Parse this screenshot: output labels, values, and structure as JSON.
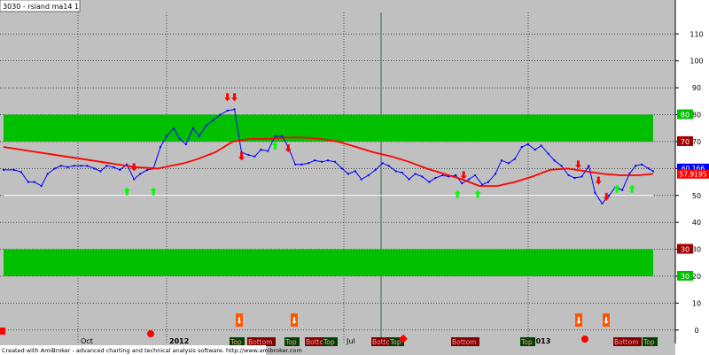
{
  "title": "3030 - rsiand ma14 1",
  "footer": "Created with AmiBroker - advanced charting and technical analysis software. http://www.amibroker.com",
  "colors": {
    "background": "#c0c0c0",
    "band": "#00c000",
    "rsi_line": "#0000ff",
    "ma_line": "#ff0000",
    "up_arrow": "#00ff00",
    "down_arrow": "#ff0000",
    "marker": "#ff0000"
  },
  "chart_data": {
    "type": "line",
    "ylim": [
      -5,
      118
    ],
    "yticks": [
      0,
      10,
      20,
      30,
      40,
      50,
      60,
      70,
      80,
      90,
      100,
      110
    ],
    "xticks": [
      {
        "label": "Oct",
        "x": 88
      },
      {
        "label": "2012",
        "x": 188
      },
      {
        "label": "Jul",
        "x": 388
      },
      {
        "label": "2013",
        "x": 596
      }
    ],
    "series": [
      {
        "id": "rsi",
        "points": [
          [
            0,
            59.5
          ],
          [
            12,
            59.5
          ],
          [
            20,
            58.7
          ],
          [
            28,
            55
          ],
          [
            35,
            55
          ],
          [
            43,
            53.5
          ],
          [
            50,
            58
          ],
          [
            58,
            60
          ],
          [
            65,
            61
          ],
          [
            73,
            60.5
          ],
          [
            80,
            61
          ],
          [
            88,
            61
          ],
          [
            95,
            61
          ],
          [
            103,
            60
          ],
          [
            110,
            59
          ],
          [
            117,
            61
          ],
          [
            125,
            60.5
          ],
          [
            132,
            59.5
          ],
          [
            140,
            61.5
          ],
          [
            148,
            56
          ],
          [
            155,
            58
          ],
          [
            163,
            59.5
          ],
          [
            170,
            60
          ],
          [
            178,
            68
          ],
          [
            185,
            72
          ],
          [
            193,
            75
          ],
          [
            200,
            71
          ],
          [
            207,
            69
          ],
          [
            215,
            75
          ],
          [
            222,
            72
          ],
          [
            230,
            76
          ],
          [
            238,
            78
          ],
          [
            246,
            80
          ],
          [
            254,
            81.5
          ],
          [
            262,
            82
          ],
          [
            270,
            66
          ],
          [
            278,
            65
          ],
          [
            285,
            64.5
          ],
          [
            292,
            67
          ],
          [
            300,
            66.5
          ],
          [
            308,
            72
          ],
          [
            316,
            72
          ],
          [
            323,
            68
          ],
          [
            331,
            61.5
          ],
          [
            338,
            61.5
          ],
          [
            346,
            62
          ],
          [
            353,
            63
          ],
          [
            361,
            62.5
          ],
          [
            368,
            63
          ],
          [
            376,
            62.5
          ],
          [
            384,
            60
          ],
          [
            391,
            58
          ],
          [
            399,
            59
          ],
          [
            406,
            56
          ],
          [
            414,
            57.5
          ],
          [
            422,
            59.5
          ],
          [
            430,
            62
          ],
          [
            437,
            61
          ],
          [
            445,
            59
          ],
          [
            452,
            58.5
          ],
          [
            460,
            56
          ],
          [
            467,
            58
          ],
          [
            475,
            57
          ],
          [
            483,
            55
          ],
          [
            490,
            56.5
          ],
          [
            498,
            57.5
          ],
          [
            505,
            57
          ],
          [
            513,
            57.5
          ],
          [
            520,
            54.5
          ],
          [
            528,
            56
          ],
          [
            535,
            57.5
          ],
          [
            543,
            54
          ],
          [
            550,
            55
          ],
          [
            558,
            58
          ],
          [
            565,
            63
          ],
          [
            573,
            62
          ],
          [
            580,
            63.5
          ],
          [
            588,
            68
          ],
          [
            595,
            69
          ],
          [
            603,
            67
          ],
          [
            610,
            68.5
          ],
          [
            618,
            65.5
          ],
          [
            625,
            63
          ],
          [
            633,
            61
          ],
          [
            641,
            57.5
          ],
          [
            648,
            56.5
          ],
          [
            656,
            57
          ],
          [
            664,
            61
          ],
          [
            671,
            51
          ],
          [
            679,
            47
          ],
          [
            687,
            50
          ],
          [
            694,
            53
          ],
          [
            702,
            52
          ],
          [
            710,
            58
          ],
          [
            717,
            61
          ],
          [
            724,
            61.5
          ],
          [
            732,
            60
          ],
          [
            737,
            59
          ]
        ]
      },
      {
        "id": "ma14",
        "points": [
          [
            0,
            68
          ],
          [
            30,
            66.5
          ],
          [
            60,
            65
          ],
          [
            90,
            63.5
          ],
          [
            120,
            62
          ],
          [
            150,
            60.5
          ],
          [
            175,
            60
          ],
          [
            190,
            61
          ],
          [
            205,
            62
          ],
          [
            220,
            63.5
          ],
          [
            240,
            66
          ],
          [
            260,
            70
          ],
          [
            280,
            71
          ],
          [
            300,
            71
          ],
          [
            320,
            71.5
          ],
          [
            340,
            71.5
          ],
          [
            360,
            71
          ],
          [
            380,
            70
          ],
          [
            400,
            68
          ],
          [
            420,
            66
          ],
          [
            440,
            64.5
          ],
          [
            460,
            62.5
          ],
          [
            480,
            60
          ],
          [
            500,
            58
          ],
          [
            520,
            56
          ],
          [
            540,
            53.5
          ],
          [
            560,
            53.5
          ],
          [
            580,
            55
          ],
          [
            600,
            57
          ],
          [
            620,
            59.5
          ],
          [
            640,
            60
          ],
          [
            660,
            59
          ],
          [
            680,
            58
          ],
          [
            700,
            57.5
          ],
          [
            720,
            57.5
          ],
          [
            737,
            58
          ]
        ]
      }
    ],
    "bands": [
      [
        70,
        80
      ],
      [
        20,
        30
      ]
    ],
    "hline": 50,
    "band_labels": [
      {
        "value": 80,
        "text": "80",
        "color": "#00c000"
      },
      {
        "value": 70,
        "text": "70",
        "color": "#a00000"
      },
      {
        "value": 30,
        "text": "30",
        "color": "#a00000"
      },
      {
        "value": 20,
        "text": "30",
        "color": "#00c000"
      }
    ],
    "last_labels": [
      {
        "value": 60.166,
        "text": "60.166",
        "color": "#0000ff"
      },
      {
        "value": 57.9,
        "text": "57.9195",
        "color": "#ff0000"
      }
    ],
    "up_arrows": [
      [
        140,
        53
      ],
      [
        170,
        53
      ],
      [
        308,
        70
      ],
      [
        515,
        52
      ],
      [
        538,
        52
      ],
      [
        696,
        54
      ],
      [
        713,
        54
      ]
    ],
    "down_arrows": [
      [
        148,
        59
      ],
      [
        254,
        85
      ],
      [
        262,
        85
      ],
      [
        270,
        63
      ],
      [
        323,
        66
      ],
      [
        522,
        56
      ],
      [
        652,
        60
      ],
      [
        675,
        54
      ],
      [
        684,
        48
      ]
    ],
    "bottom_signals": [
      {
        "x": 270,
        "label": "Top"
      },
      {
        "x": 332,
        "label": ""
      },
      {
        "x": 653,
        "label": ""
      },
      {
        "x": 684,
        "label": ""
      }
    ],
    "bottom_labels": [
      {
        "x": 260,
        "text": "Top"
      },
      {
        "x": 280,
        "text": "Bottom"
      },
      {
        "x": 322,
        "text": "Top"
      },
      {
        "x": 345,
        "text": "Bottom"
      },
      {
        "x": 365,
        "text": "Top"
      },
      {
        "x": 420,
        "text": "Bottom"
      },
      {
        "x": 440,
        "text": "Top"
      },
      {
        "x": 510,
        "text": "Bottom"
      },
      {
        "x": 588,
        "text": "Top"
      },
      {
        "x": 693,
        "text": "Bottom"
      },
      {
        "x": 726,
        "text": "Top"
      }
    ]
  }
}
